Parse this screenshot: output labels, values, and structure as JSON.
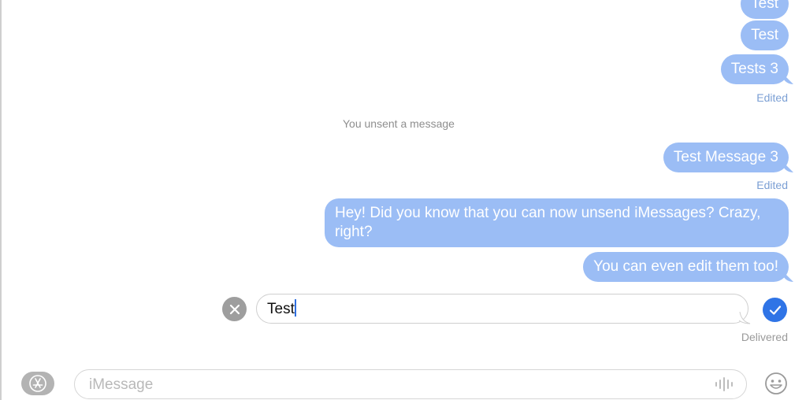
{
  "messages": [
    {
      "text": "Test"
    },
    {
      "text": "Test"
    },
    {
      "text": "Tests 3"
    },
    {
      "text": "Test Message 3"
    },
    {
      "text": "Hey! Did you know that you can now unsend iMessages? Crazy, right?"
    },
    {
      "text": "You can even edit them too!"
    }
  ],
  "status": {
    "edited_1": "Edited",
    "edited_2": "Edited",
    "unsent_note": "You unsent a message",
    "delivered": "Delivered"
  },
  "edit": {
    "value": "Test"
  },
  "compose": {
    "placeholder": "iMessage"
  },
  "icons": {
    "cancel": "close-icon",
    "confirm": "checkmark-icon",
    "apps": "app-store-icon",
    "audio": "audio-waveform-icon",
    "emoji": "emoji-icon"
  },
  "colors": {
    "bubble": "#9bbdf5",
    "accent": "#2f74e6"
  }
}
